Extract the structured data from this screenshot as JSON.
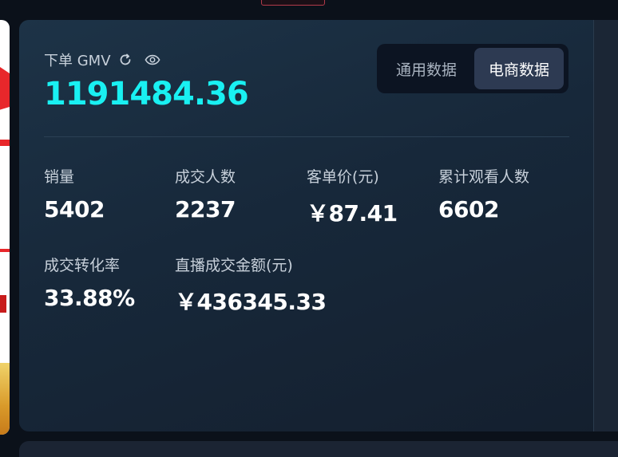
{
  "accent_color": "#19f0f2",
  "header": {
    "title": "下单 GMV",
    "refresh_icon": "refresh-icon",
    "visibility_icon": "eye-icon",
    "main_value": "1191484.36"
  },
  "tabs": [
    {
      "label": "通用数据",
      "active": false
    },
    {
      "label": "电商数据",
      "active": true
    }
  ],
  "stats": [
    {
      "label": "销量",
      "value": "5402"
    },
    {
      "label": "成交人数",
      "value": "2237"
    },
    {
      "label": "客单价(元)",
      "value": "￥87.41"
    },
    {
      "label": "累计观看人数",
      "value": "6602"
    },
    {
      "label": "成交转化率",
      "value": "33.88%"
    },
    {
      "label": "直播成交金额(元)",
      "value": "￥436345.33"
    }
  ]
}
